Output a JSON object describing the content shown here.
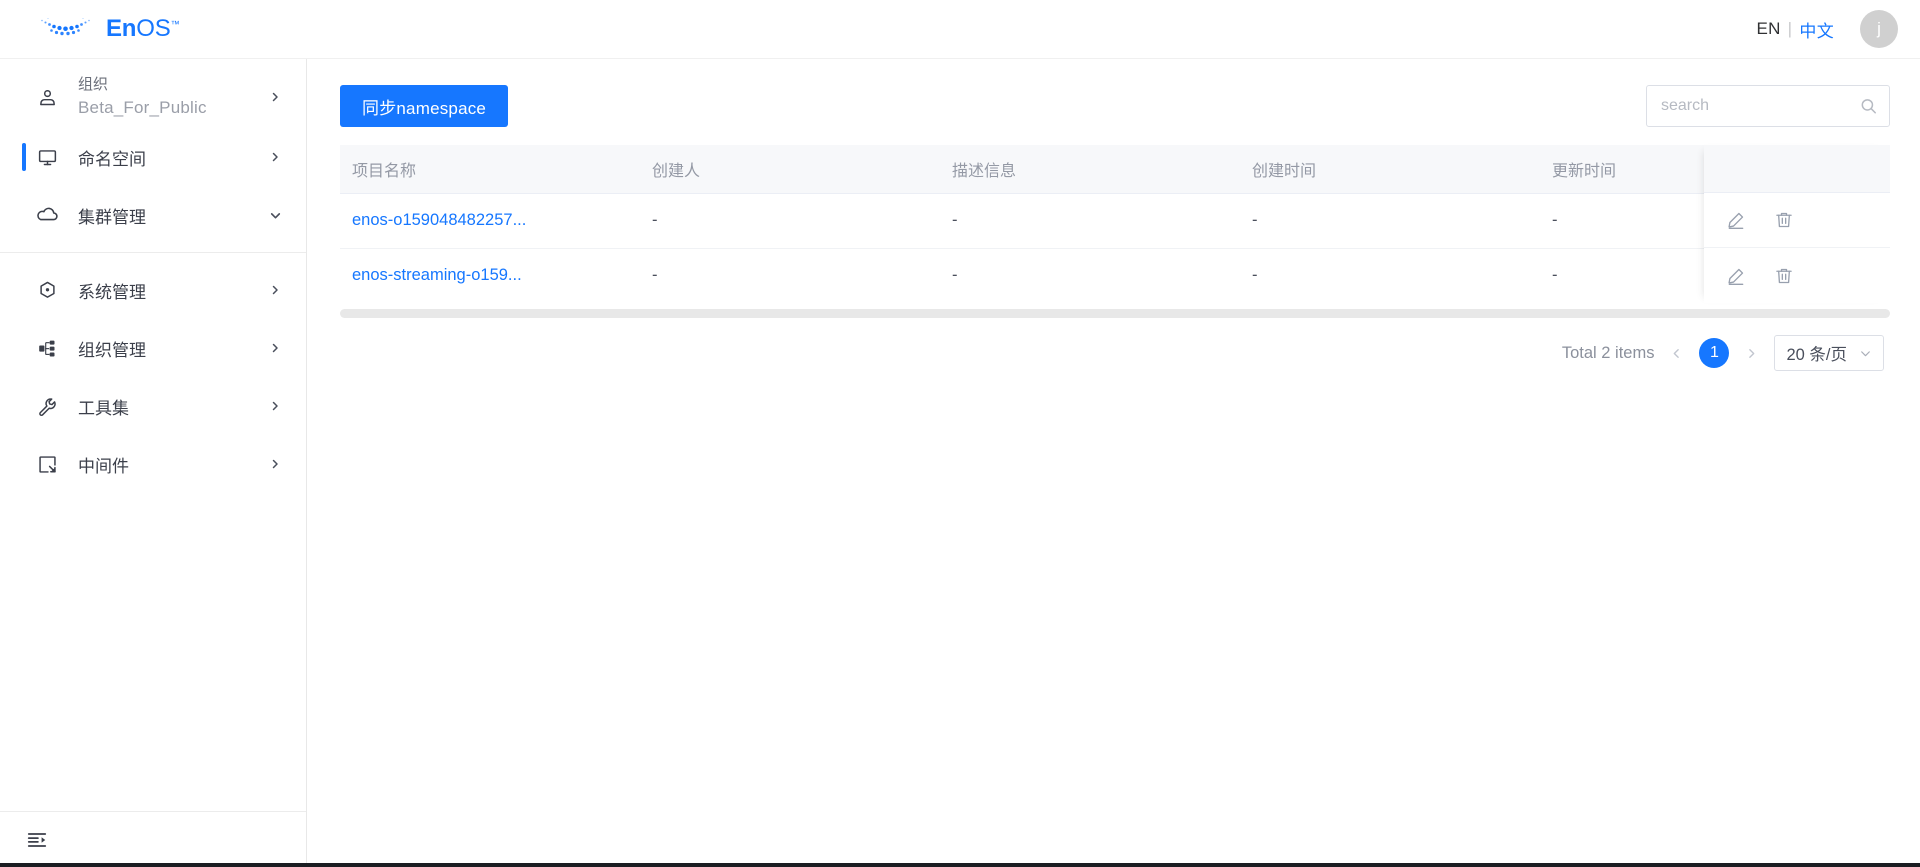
{
  "header": {
    "brand": {
      "name_bold": "En",
      "name_light": "OS",
      "tm": "™",
      "logo_icon": "enos-dots-logo"
    },
    "lang_en": "EN",
    "lang_sep": "|",
    "lang_zh": "中文",
    "avatar_initial": "j"
  },
  "sidebar": {
    "org": {
      "title": "组织",
      "name": "Beta_For_Public",
      "icon": "user-org-icon",
      "chevron": "chevron-right-icon"
    },
    "items": [
      {
        "label": "命名空间",
        "icon": "display-monitor-icon",
        "chevron": "chevron-right-icon",
        "selected": true
      },
      {
        "label": "集群管理",
        "icon": "cloud-icon",
        "chevron": "chevron-down-icon",
        "selected": false
      },
      {
        "label": "系统管理",
        "icon": "hexagon-gear-icon",
        "chevron": "chevron-right-icon",
        "selected": false
      },
      {
        "label": "组织管理",
        "icon": "org-tree-icon",
        "chevron": "chevron-right-icon",
        "selected": false
      },
      {
        "label": "工具集",
        "icon": "wrench-icon",
        "chevron": "chevron-right-icon",
        "selected": false
      },
      {
        "label": "中间件",
        "icon": "middleware-box-icon",
        "chevron": "chevron-right-icon",
        "selected": false
      }
    ],
    "footer": {
      "fold_icon": "menu-fold-icon"
    }
  },
  "toolbar": {
    "sync_button": "同步namespace",
    "search_placeholder": "search",
    "search_value": "",
    "search_icon": "search-icon"
  },
  "table": {
    "columns": [
      "项目名称",
      "创建人",
      "描述信息",
      "创建时间",
      "更新时间"
    ],
    "rows": [
      {
        "name": "enos-o159048482257...",
        "creator": "-",
        "description": "-",
        "create_time": "-",
        "update_time": "-"
      },
      {
        "name": "enos-streaming-o159...",
        "creator": "-",
        "description": "-",
        "create_time": "-",
        "update_time": "-"
      }
    ],
    "actions": {
      "edit_icon": "pencil-edit-icon",
      "delete_icon": "trash-delete-icon"
    }
  },
  "pagination": {
    "total_text": "Total 2 items",
    "prev_icon": "chevron-left-icon",
    "next_icon": "chevron-right-icon",
    "current_page": "1",
    "page_size": "20 条/页",
    "caret_icon": "chevron-down-icon"
  },
  "colors": {
    "accent": "#1677ff",
    "header_bg": "#f7f8fa",
    "text": "#3b3f4a",
    "muted": "#9499a5",
    "border": "#ebeef5"
  }
}
